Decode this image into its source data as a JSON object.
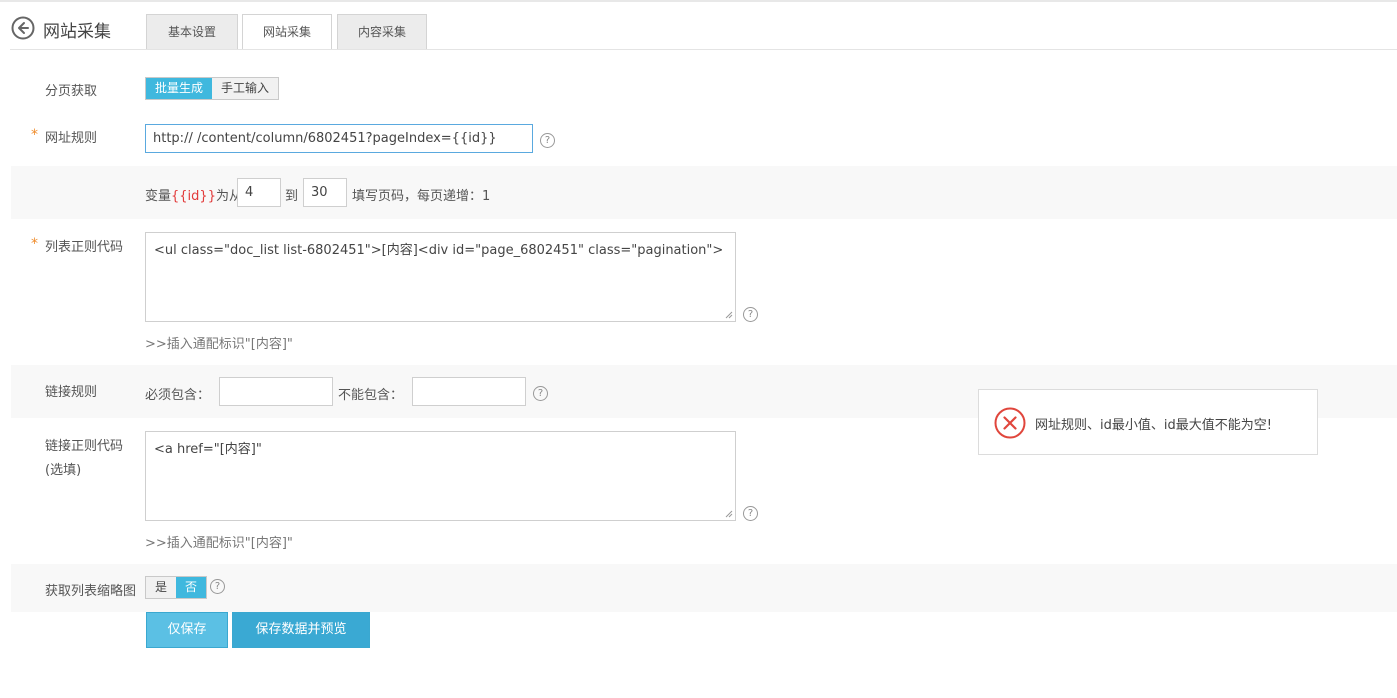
{
  "header": {
    "title": "网站采集",
    "tabs": [
      {
        "label": "基本设置"
      },
      {
        "label": "网站采集"
      },
      {
        "label": "内容采集"
      }
    ]
  },
  "paging": {
    "label": "分页获取",
    "options": [
      "批量生成",
      "手工输入"
    ],
    "selected": "批量生成"
  },
  "url_rule": {
    "required_mark": "*",
    "label": "网址规则",
    "value": "http://       /content/column/6802451?pageIndex={{id}}",
    "help": "?"
  },
  "variable": {
    "prefix": "变量",
    "var": "{{id}}",
    "from_text": "为从",
    "from_value": "4",
    "to_text": "到",
    "to_value": "30",
    "suffix": "填写页码，每页递增：1"
  },
  "list_regex": {
    "required_mark": "*",
    "label": "列表正则代码",
    "value": "<ul class=\"doc_list list-6802451\">[内容]<div id=\"page_6802451\" class=\"pagination\">",
    "insert_link": ">>插入通配标识\"[内容]\"",
    "help": "?"
  },
  "link_rule": {
    "label": "链接规则",
    "must_contain_label": "必须包含：",
    "must_contain_value": "",
    "cannot_contain_label": "不能包含：",
    "cannot_contain_value": "",
    "help": "?"
  },
  "link_regex": {
    "label_line1": "链接正则代码",
    "label_line2": "(选填)",
    "value": "<a href=\"[内容]\"",
    "insert_link": ">>插入通配标识\"[内容]\"",
    "help": "?"
  },
  "thumbnail": {
    "label": "获取列表缩略图",
    "options": [
      "是",
      "否"
    ],
    "selected": "否",
    "help": "?"
  },
  "actions": {
    "save_only": "仅保存",
    "save_preview": "保存数据并预览"
  },
  "toast": {
    "message": "网址规则、id最小值、id最大值不能为空!",
    "accent": "#e0463c"
  },
  "colors": {
    "primary": "#3fb8de",
    "required": "#ef8b2a",
    "variable": "#e23a3a"
  }
}
